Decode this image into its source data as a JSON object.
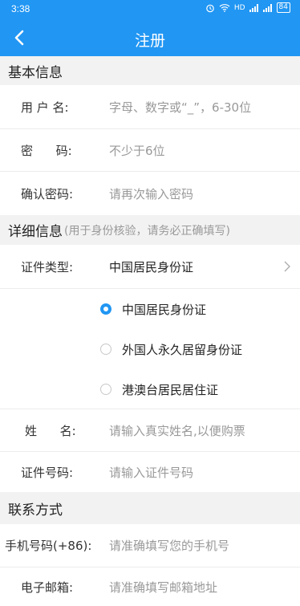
{
  "status_bar": {
    "time": "3:38",
    "network": "HD",
    "battery": "84"
  },
  "nav": {
    "title": "注册"
  },
  "sections": {
    "basic": {
      "title": "基本信息"
    },
    "detail": {
      "title": "详细信息",
      "note": "(用于身份核验，请务必正确填写)"
    },
    "contact": {
      "title": "联系方式"
    }
  },
  "fields": {
    "username": {
      "label": "用 户 名:",
      "placeholder": "字母、数字或“_”，6-30位"
    },
    "password": {
      "label": "密      码:",
      "placeholder": "不少于6位"
    },
    "confirm_password": {
      "label": "确认密码:",
      "placeholder": "请再次输入密码"
    },
    "id_type": {
      "label": "证件类型:",
      "value": "中国居民身份证"
    },
    "name": {
      "label": "姓      名:",
      "placeholder": "请输入真实姓名,以便购票"
    },
    "id_number": {
      "label": "证件号码:",
      "placeholder": "请输入证件号码"
    },
    "phone": {
      "label": "手机号码(+86):",
      "placeholder": "请准确填写您的手机号"
    },
    "email": {
      "label": "电子邮箱:",
      "placeholder": "请准确填写邮箱地址"
    }
  },
  "id_type_options": [
    {
      "label": "中国居民身份证",
      "selected": true
    },
    {
      "label": "外国人永久居留身份证",
      "selected": false
    },
    {
      "label": "港澳台居民居住证",
      "selected": false
    }
  ],
  "colors": {
    "brand": "#2196F3",
    "section_bg": "#f2f2f2"
  },
  "icons": {
    "back": "chevron-left",
    "expand": "chevron-right"
  }
}
